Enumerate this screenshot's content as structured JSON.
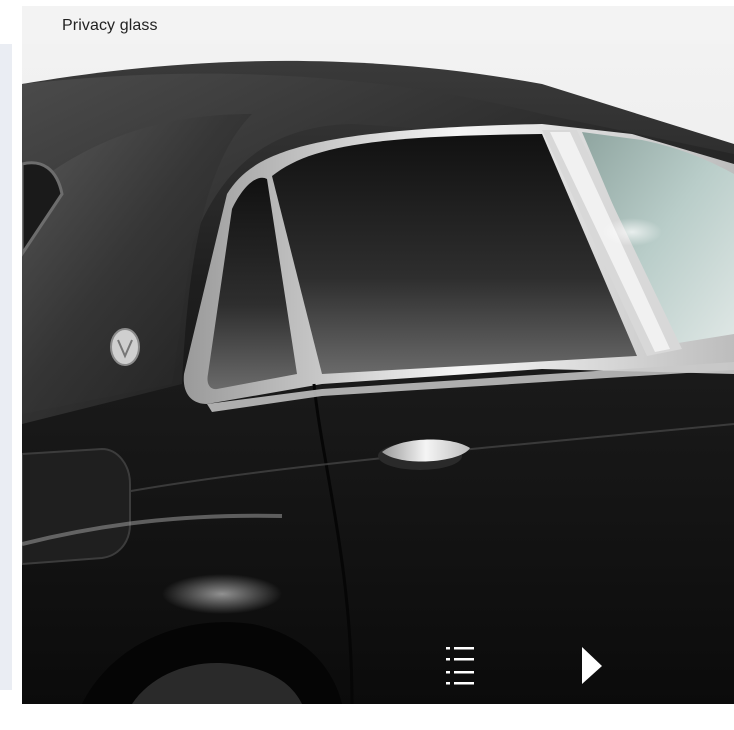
{
  "header": {
    "title": "Privacy glass"
  },
  "controls": {
    "list_icon": "list-icon",
    "next_icon": "play-next-icon"
  },
  "colors": {
    "header_bg": "#f3f3f3",
    "side_strip": "#eaedf3",
    "icon_color": "#ffffff"
  }
}
